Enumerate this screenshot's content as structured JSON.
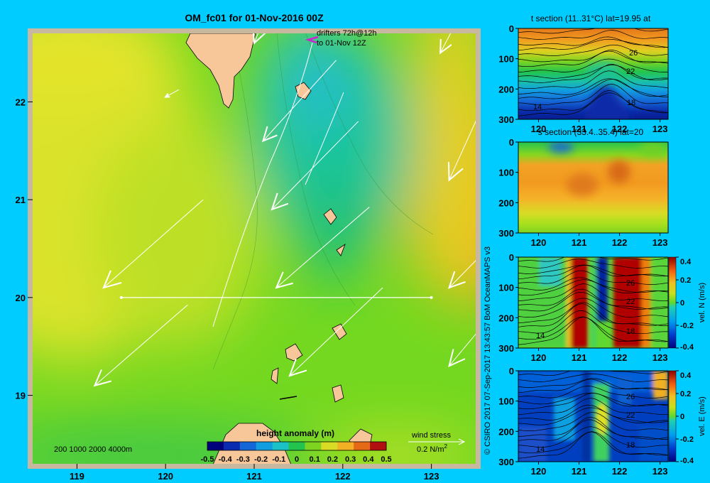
{
  "chart_data": [
    {
      "type": "heatmap",
      "title": "OM_fc01 for 01-Nov-2016 00Z",
      "xlim": [
        118.5,
        123.5
      ],
      "ylim": [
        18.3,
        22.7
      ],
      "x_ticks": [
        "119",
        "120",
        "121",
        "122",
        "123"
      ],
      "y_ticks": [
        "19",
        "20",
        "21",
        "22"
      ],
      "x_tick_values": [
        119,
        120,
        121,
        122,
        123
      ],
      "y_tick_values": [
        19,
        20,
        21,
        22
      ],
      "drifters_label": "drifters 72h@12h",
      "drifters_date": "to 01-Nov 12Z",
      "depth_legend": "200  1000  2000  4000m",
      "colorbar": {
        "label": "height anomaly (m)",
        "ticks": [
          "-0.5",
          "-0.4",
          "-0.3",
          "-0.2",
          "-0.1",
          "0",
          "0.1",
          "0.2",
          "0.3",
          "0.4",
          "0.5"
        ],
        "range": [
          -0.5,
          0.5
        ]
      },
      "wind_legend": {
        "title": "wind stress",
        "value": "0.2 N/m",
        "superscript": "2"
      },
      "section_line": {
        "lat": 20,
        "lon_start": 119.5,
        "lon_end": 123
      },
      "anomaly_field": [
        {
          "lon": 121.9,
          "lat": 21.8,
          "value": -0.12
        },
        {
          "lon": 122.4,
          "lat": 21.0,
          "value": -0.05
        },
        {
          "lon": 121.8,
          "lat": 20.6,
          "value": -0.02
        },
        {
          "lon": 123.3,
          "lat": 21.0,
          "value": 0.32
        },
        {
          "lon": 123.1,
          "lat": 20.2,
          "value": 0.25
        },
        {
          "lon": 119.2,
          "lat": 21.0,
          "value": 0.15
        },
        {
          "lon": 119.0,
          "lat": 22.5,
          "value": 0.17
        },
        {
          "lon": 120.0,
          "lat": 18.4,
          "value": -0.02
        }
      ],
      "wind_vectors": [
        {
          "lon": 120.0,
          "lat": 22.05,
          "u": -0.02,
          "v": -0.01
        },
        {
          "lon": 121.0,
          "lat": 22.6,
          "u": -0.08,
          "v": -0.18
        },
        {
          "lon": 121.1,
          "lat": 21.6,
          "u": -0.11,
          "v": -0.11
        },
        {
          "lon": 121.2,
          "lat": 20.9,
          "u": -0.13,
          "v": -0.12
        },
        {
          "lon": 119.3,
          "lat": 20.1,
          "u": -0.15,
          "v": -0.12
        },
        {
          "lon": 121.25,
          "lat": 20.1,
          "u": -0.14,
          "v": -0.11
        },
        {
          "lon": 123.2,
          "lat": 20.1,
          "u": -0.13,
          "v": -0.12
        },
        {
          "lon": 119.2,
          "lat": 19.1,
          "u": -0.14,
          "v": -0.11
        },
        {
          "lon": 121.4,
          "lat": 19.2,
          "u": -0.14,
          "v": -0.12
        },
        {
          "lon": 123.2,
          "lat": 19.3,
          "u": -0.12,
          "v": -0.13
        },
        {
          "lon": 123.1,
          "lat": 22.5,
          "u": -0.07,
          "v": -0.12
        },
        {
          "lon": 123.2,
          "lat": 21.2,
          "u": -0.08,
          "v": -0.16
        }
      ]
    },
    {
      "type": "heatmap",
      "title": "t section (11..31°C) lat=19.95 at",
      "xlim": [
        119.5,
        123.2
      ],
      "ylim": [
        300,
        0
      ],
      "x_ticks": [
        "120",
        "121",
        "122",
        "123"
      ],
      "y_ticks": [
        "0",
        "100",
        "200",
        "300"
      ],
      "contour_labels": [
        "26",
        "22",
        "18",
        "14"
      ]
    },
    {
      "type": "heatmap",
      "title": "s section (33.4..35.4) lat=20",
      "xlim": [
        119.5,
        123.2
      ],
      "ylim": [
        300,
        0
      ],
      "x_ticks": [
        "120",
        "121",
        "122",
        "123"
      ],
      "y_ticks": [
        "0",
        "100",
        "200",
        "300"
      ]
    },
    {
      "type": "heatmap",
      "title": "",
      "xlim": [
        119.5,
        123.2
      ],
      "ylim": [
        300,
        0
      ],
      "x_ticks": [
        "120",
        "121",
        "122",
        "123"
      ],
      "y_ticks": [
        "0",
        "100",
        "200",
        "300"
      ],
      "contour_labels": [
        "26",
        "22",
        "18",
        "14"
      ],
      "colorbar": {
        "label": "vel. N  (m/s)",
        "ticks": [
          "0.4",
          "0.2",
          "0",
          "-0.2",
          "-0.4"
        ],
        "range": [
          -0.4,
          0.4
        ]
      }
    },
    {
      "type": "heatmap",
      "title": "",
      "xlim": [
        119.5,
        123.2
      ],
      "ylim": [
        300,
        0
      ],
      "x_ticks": [
        "120",
        "121",
        "122",
        "123"
      ],
      "y_ticks": [
        "0",
        "100",
        "200",
        "300"
      ],
      "contour_labels": [
        "26",
        "22",
        "18",
        "14"
      ],
      "colorbar": {
        "label": "vel. E  (m/s)",
        "ticks": [
          "0.4",
          "0.2",
          "0",
          "-0.2",
          "-0.4"
        ],
        "range": [
          -0.4,
          0.4
        ]
      }
    }
  ],
  "credit": "© CSIRO 2017   07-Sep-2017 13:43:57 BoM OceanMAPS v3"
}
